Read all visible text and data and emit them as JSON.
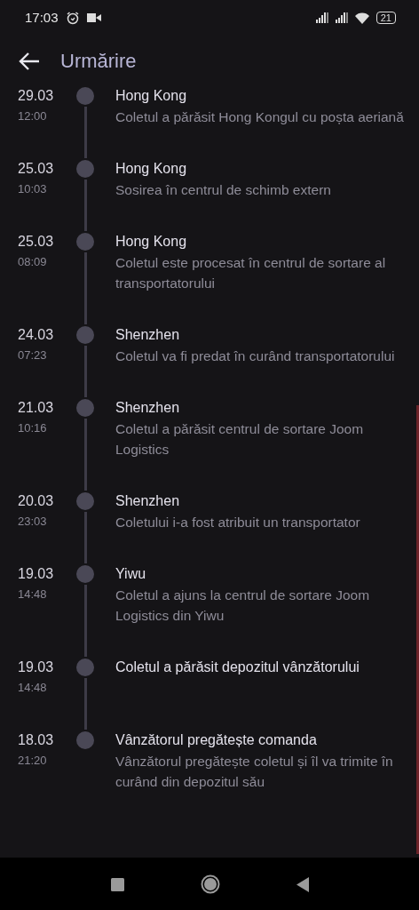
{
  "status_bar": {
    "time": "17:03",
    "battery": "21"
  },
  "header": {
    "title": "Urmărire"
  },
  "events": [
    {
      "date": "29.03",
      "time": "12:00",
      "location": "Hong Kong",
      "description": "Coletul a părăsit Hong Kongul cu poșta aeriană"
    },
    {
      "date": "25.03",
      "time": "10:03",
      "location": "Hong Kong",
      "description": "Sosirea în centrul de schimb extern"
    },
    {
      "date": "25.03",
      "time": "08:09",
      "location": "Hong Kong",
      "description": "Coletul este procesat în centrul de sortare al transportatorului"
    },
    {
      "date": "24.03",
      "time": "07:23",
      "location": "Shenzhen",
      "description": "Coletul va fi predat în curând transportatorului"
    },
    {
      "date": "21.03",
      "time": "10:16",
      "location": "Shenzhen",
      "description": "Coletul a părăsit centrul de sortare Joom Logistics"
    },
    {
      "date": "20.03",
      "time": "23:03",
      "location": "Shenzhen",
      "description": "Coletului i-a fost atribuit un transportator"
    },
    {
      "date": "19.03",
      "time": "14:48",
      "location": "Yiwu",
      "description": "Coletul a ajuns la centrul de sortare Joom Logistics din Yiwu"
    },
    {
      "date": "19.03",
      "time": "14:48",
      "location": "Coletul a părăsit depozitul vânzătorului"
    },
    {
      "date": "18.03",
      "time": "21:20",
      "location": "Vânzătorul pregătește comanda",
      "description": "Vânzătorul pregătește coletul și îl va trimite în curând din depozitul său"
    }
  ]
}
